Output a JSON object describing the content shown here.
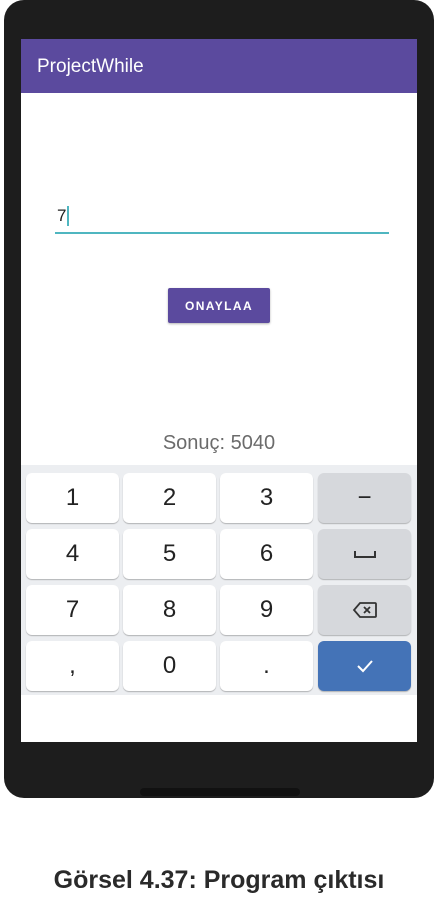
{
  "app": {
    "title": "ProjectWhile"
  },
  "input": {
    "value": "7"
  },
  "confirm_button": {
    "label": "ONAYLAA"
  },
  "result": {
    "text": "Sonuç: 5040"
  },
  "keyboard": {
    "rows": [
      [
        "1",
        "2",
        "3",
        "−"
      ],
      [
        "4",
        "5",
        "6",
        "space-icon"
      ],
      [
        "7",
        "8",
        "9",
        "backspace-icon"
      ],
      [
        ",",
        "0",
        ".",
        "check-icon"
      ]
    ]
  },
  "caption": "Görsel 4.37: Program çıktısı",
  "colors": {
    "app_bar": "#5b4a9e",
    "accent": "#4fb6c0",
    "button": "#5b4a9e",
    "enter_key": "#4473b7"
  }
}
